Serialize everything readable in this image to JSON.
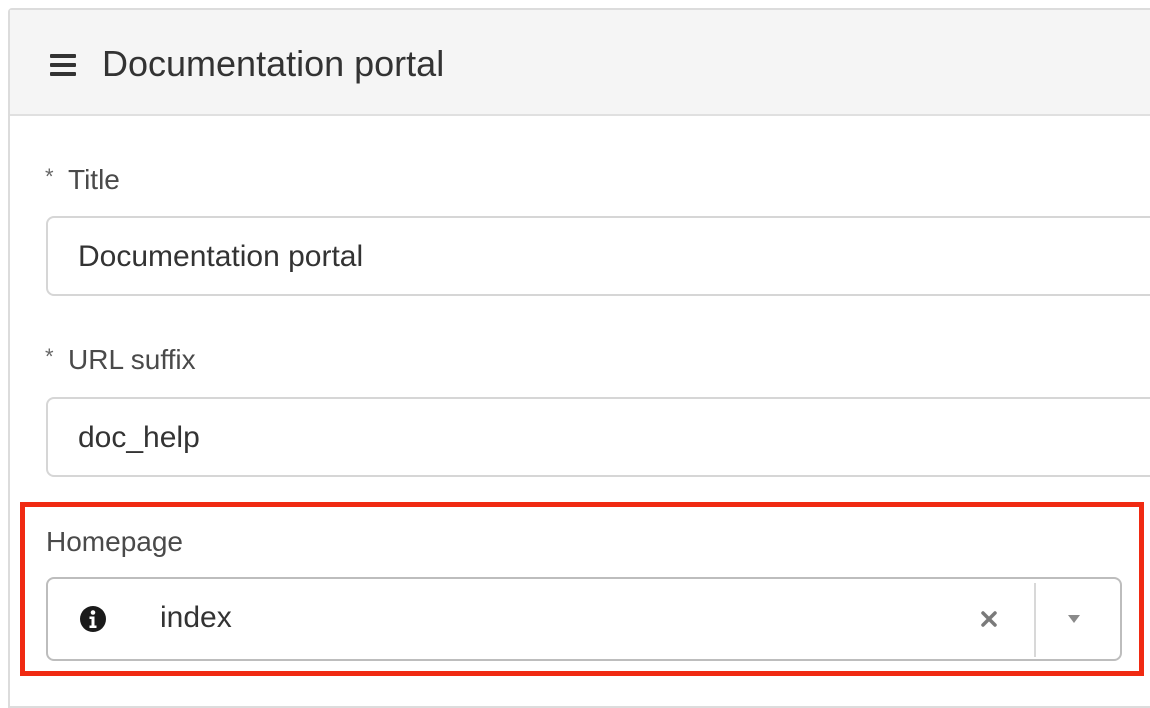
{
  "header": {
    "title": "Documentation portal",
    "menu_icon": "hamburger-menu-icon"
  },
  "form": {
    "title_field": {
      "required_marker": "*",
      "label": "Title",
      "value": "Documentation portal"
    },
    "url_field": {
      "required_marker": "*",
      "label": "URL suffix",
      "value": "doc_help"
    },
    "homepage_field": {
      "label": "Homepage",
      "selected_value": "index",
      "leading_icon": "info-icon",
      "clear_icon": "close-icon",
      "dropdown_icon": "caret-down-icon"
    }
  },
  "colors": {
    "highlight_border": "#f02a12",
    "header_bg": "#f5f5f5",
    "text": "#333333"
  }
}
